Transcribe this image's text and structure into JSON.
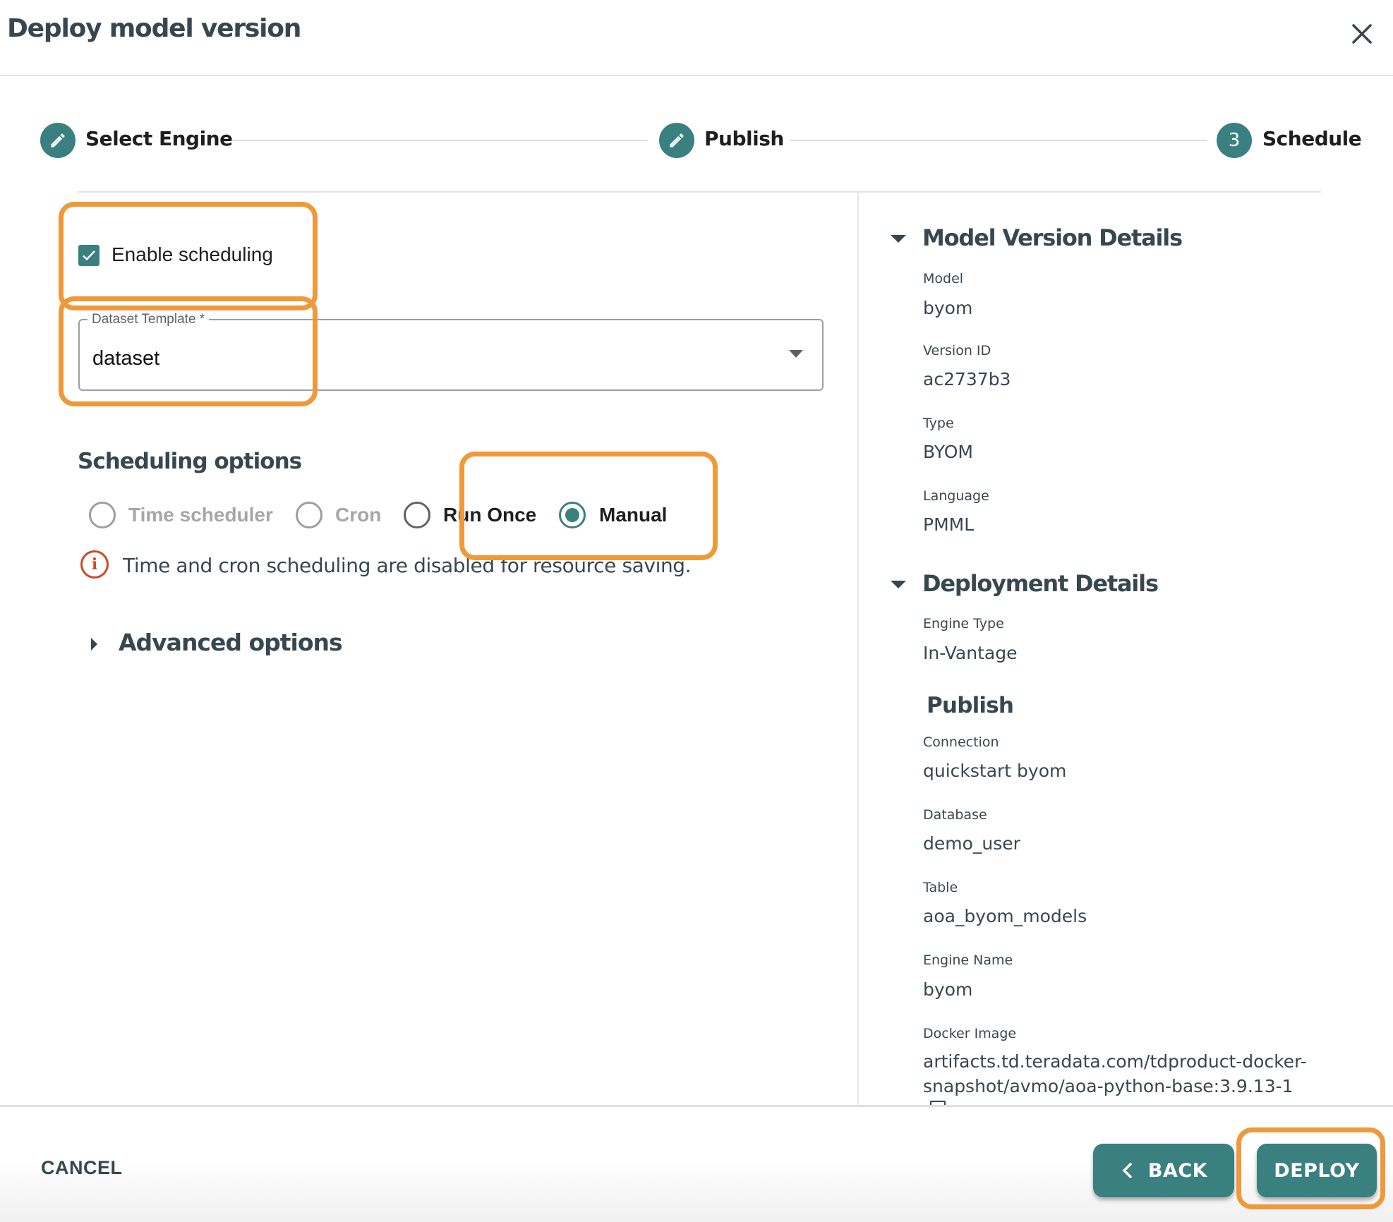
{
  "dialog": {
    "title": "Deploy model version",
    "close_icon": "close-icon"
  },
  "stepper": {
    "steps": [
      {
        "label": "Select Engine",
        "icon": "pencil-icon",
        "state": "completed"
      },
      {
        "label": "Publish",
        "icon": "pencil-icon",
        "state": "completed"
      },
      {
        "label": "Schedule",
        "number": "3",
        "state": "active"
      }
    ]
  },
  "schedule": {
    "enable_scheduling": {
      "label": "Enable scheduling",
      "checked": true
    },
    "dataset_template": {
      "label": "Dataset Template *",
      "value": "dataset"
    },
    "scheduling_options": {
      "heading": "Scheduling options",
      "options": [
        {
          "label": "Time scheduler",
          "disabled": true,
          "selected": false
        },
        {
          "label": "Cron",
          "disabled": true,
          "selected": false
        },
        {
          "label": "Run Once",
          "disabled": false,
          "selected": false
        },
        {
          "label": "Manual",
          "disabled": false,
          "selected": true
        }
      ],
      "info": "Time and cron scheduling are disabled for resource saving."
    },
    "advanced_options": "Advanced options"
  },
  "details": {
    "model_version": {
      "heading": "Model Version Details",
      "fields": [
        {
          "label": "Model",
          "value": "byom"
        },
        {
          "label": "Version ID",
          "value": "ac2737b3"
        },
        {
          "label": "Type",
          "value": "BYOM"
        },
        {
          "label": "Language",
          "value": "PMML"
        }
      ]
    },
    "deployment": {
      "heading": "Deployment Details",
      "fields": [
        {
          "label": "Engine Type",
          "value": "In-Vantage"
        }
      ],
      "publish_heading": "Publish",
      "publish_fields": [
        {
          "label": "Connection",
          "value": "quickstart byom"
        },
        {
          "label": "Database",
          "value": "demo_user"
        },
        {
          "label": "Table",
          "value": "aoa_byom_models"
        },
        {
          "label": "Engine Name",
          "value": "byom"
        },
        {
          "label": "Docker Image",
          "value_line1": "artifacts.td.teradata.com/tdproduct-docker-",
          "value_line2": "snapshot/avmo/aoa-python-base:3.9.13-1"
        }
      ]
    }
  },
  "footer": {
    "cancel_label": "CANCEL",
    "back_label": "BACK",
    "deploy_label": "DEPLOY"
  },
  "colors": {
    "accent": "#3a8080",
    "highlight": "#f0993a",
    "text": "#37474f",
    "warning": "#cf4a27"
  }
}
